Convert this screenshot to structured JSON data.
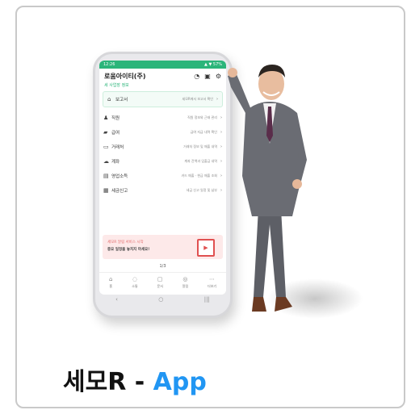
{
  "caption": {
    "title_main": "세모R - ",
    "title_accent": "App"
  },
  "phone": {
    "status_left": "12:26",
    "status_right": "▲ ▼ 57%",
    "company": "로움아이티(주)",
    "biz_link": "세 사업장 정보",
    "menu": [
      {
        "icon": "home-icon",
        "glyph": "⌂",
        "label": "보고서",
        "desc": "세모R에서 보고서 확인"
      },
      {
        "icon": "people-icon",
        "glyph": "👥",
        "label": "직원",
        "desc": "직원 정보와 근태 관리"
      },
      {
        "icon": "truck-icon",
        "glyph": "🚚",
        "label": "급여",
        "desc": "급여 지급 내역 확인"
      },
      {
        "icon": "store-icon",
        "glyph": "🏪",
        "label": "거래처",
        "desc": "거래처 정보 및 매출 내역"
      },
      {
        "icon": "cloud-icon",
        "glyph": "☁",
        "label": "계좌",
        "desc": "계좌 잔액과 입출금 내역"
      },
      {
        "icon": "doc-icon",
        "glyph": "▤",
        "label": "영업소득",
        "desc": "카드 매출 · 현금 매출 조회"
      },
      {
        "icon": "calendar-icon",
        "glyph": "▦",
        "label": "세금신고",
        "desc": "세금 신고 일정 및 납부"
      }
    ],
    "banner_line1": "세모R 알림 서비스 시작",
    "banner_line2": "중요 일정을 놓치지 마세요!",
    "pager": "1/3",
    "tabs": [
      {
        "icon": "home-icon",
        "glyph": "⌂",
        "label": "홈"
      },
      {
        "icon": "chat-icon",
        "glyph": "◌",
        "label": "소통"
      },
      {
        "icon": "doc-icon",
        "glyph": "▢",
        "label": "문서"
      },
      {
        "icon": "bell-icon",
        "glyph": "◎",
        "label": "알림"
      },
      {
        "icon": "more-icon",
        "glyph": "⋯",
        "label": "더보기"
      }
    ],
    "nav": [
      "‹",
      "○",
      "|||"
    ]
  }
}
